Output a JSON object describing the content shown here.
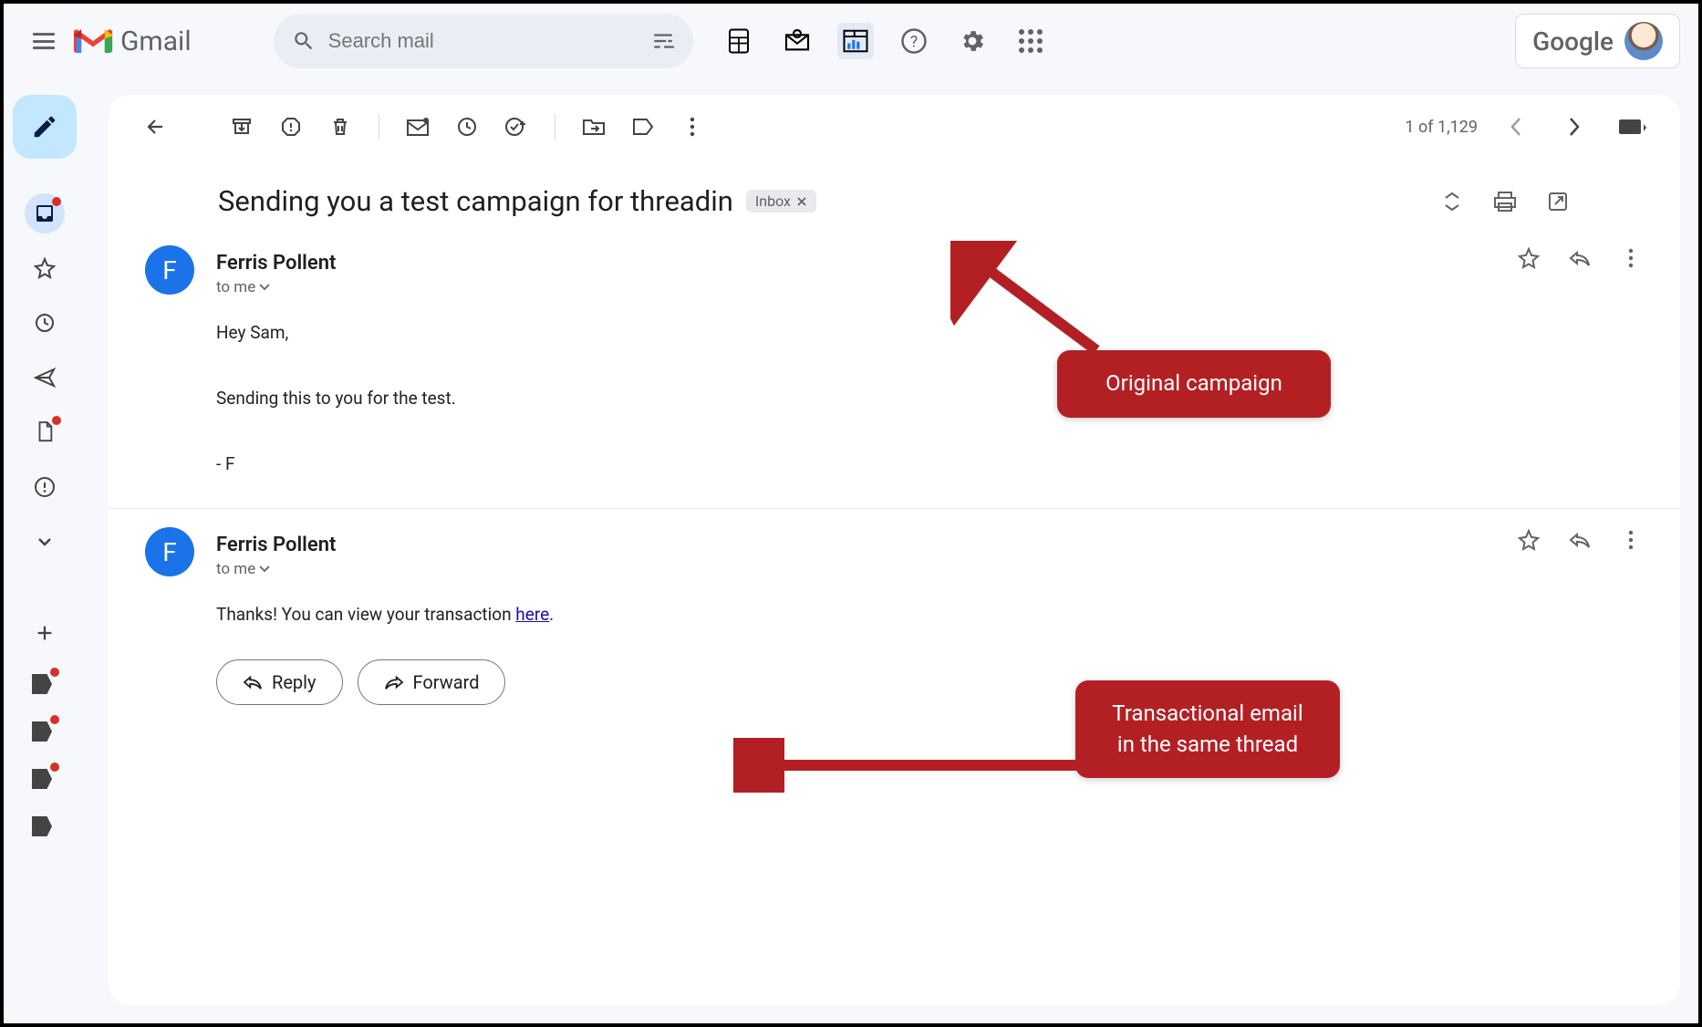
{
  "app": {
    "title": "Gmail",
    "search_placeholder": "Search mail",
    "google_brand": "Google"
  },
  "toolbar": {
    "position_text": "1 of 1,129"
  },
  "thread": {
    "subject": "Sending you a test campaign for threadin",
    "label": "Inbox"
  },
  "messages": [
    {
      "avatar_initial": "F",
      "sender": "Ferris Pollent",
      "to": "to me",
      "greeting": "Hey Sam,",
      "body": "Sending this to you for the test.",
      "signoff": "- F"
    },
    {
      "avatar_initial": "F",
      "sender": "Ferris Pollent",
      "to": "to me",
      "body_prefix": "Thanks! You can view your transaction ",
      "link_text": "here",
      "body_suffix": "."
    }
  ],
  "actions": {
    "reply": "Reply",
    "forward": "Forward"
  },
  "annotations": {
    "callout1": "Original campaign",
    "callout2": "Transactional email in the same thread"
  }
}
